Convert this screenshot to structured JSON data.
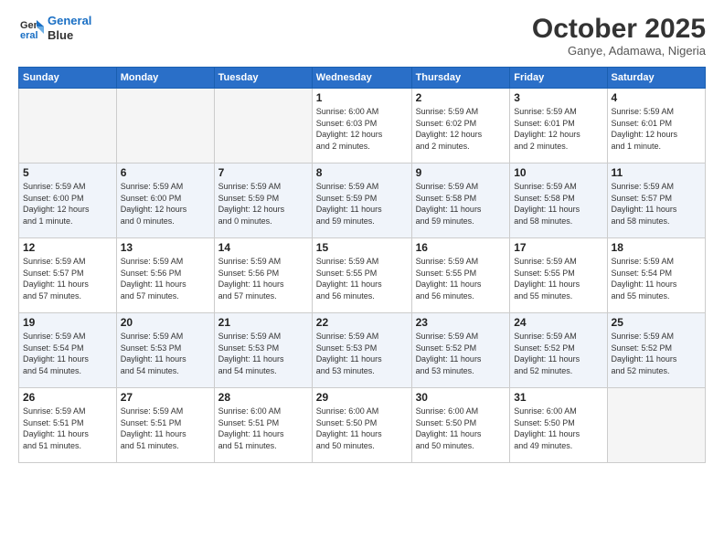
{
  "header": {
    "logo_line1": "General",
    "logo_line2": "Blue",
    "month": "October 2025",
    "location": "Ganye, Adamawa, Nigeria"
  },
  "weekdays": [
    "Sunday",
    "Monday",
    "Tuesday",
    "Wednesday",
    "Thursday",
    "Friday",
    "Saturday"
  ],
  "weeks": [
    [
      {
        "day": "",
        "info": ""
      },
      {
        "day": "",
        "info": ""
      },
      {
        "day": "",
        "info": ""
      },
      {
        "day": "1",
        "info": "Sunrise: 6:00 AM\nSunset: 6:03 PM\nDaylight: 12 hours\nand 2 minutes."
      },
      {
        "day": "2",
        "info": "Sunrise: 5:59 AM\nSunset: 6:02 PM\nDaylight: 12 hours\nand 2 minutes."
      },
      {
        "day": "3",
        "info": "Sunrise: 5:59 AM\nSunset: 6:01 PM\nDaylight: 12 hours\nand 2 minutes."
      },
      {
        "day": "4",
        "info": "Sunrise: 5:59 AM\nSunset: 6:01 PM\nDaylight: 12 hours\nand 1 minute."
      }
    ],
    [
      {
        "day": "5",
        "info": "Sunrise: 5:59 AM\nSunset: 6:00 PM\nDaylight: 12 hours\nand 1 minute."
      },
      {
        "day": "6",
        "info": "Sunrise: 5:59 AM\nSunset: 6:00 PM\nDaylight: 12 hours\nand 0 minutes."
      },
      {
        "day": "7",
        "info": "Sunrise: 5:59 AM\nSunset: 5:59 PM\nDaylight: 12 hours\nand 0 minutes."
      },
      {
        "day": "8",
        "info": "Sunrise: 5:59 AM\nSunset: 5:59 PM\nDaylight: 11 hours\nand 59 minutes."
      },
      {
        "day": "9",
        "info": "Sunrise: 5:59 AM\nSunset: 5:58 PM\nDaylight: 11 hours\nand 59 minutes."
      },
      {
        "day": "10",
        "info": "Sunrise: 5:59 AM\nSunset: 5:58 PM\nDaylight: 11 hours\nand 58 minutes."
      },
      {
        "day": "11",
        "info": "Sunrise: 5:59 AM\nSunset: 5:57 PM\nDaylight: 11 hours\nand 58 minutes."
      }
    ],
    [
      {
        "day": "12",
        "info": "Sunrise: 5:59 AM\nSunset: 5:57 PM\nDaylight: 11 hours\nand 57 minutes."
      },
      {
        "day": "13",
        "info": "Sunrise: 5:59 AM\nSunset: 5:56 PM\nDaylight: 11 hours\nand 57 minutes."
      },
      {
        "day": "14",
        "info": "Sunrise: 5:59 AM\nSunset: 5:56 PM\nDaylight: 11 hours\nand 57 minutes."
      },
      {
        "day": "15",
        "info": "Sunrise: 5:59 AM\nSunset: 5:55 PM\nDaylight: 11 hours\nand 56 minutes."
      },
      {
        "day": "16",
        "info": "Sunrise: 5:59 AM\nSunset: 5:55 PM\nDaylight: 11 hours\nand 56 minutes."
      },
      {
        "day": "17",
        "info": "Sunrise: 5:59 AM\nSunset: 5:55 PM\nDaylight: 11 hours\nand 55 minutes."
      },
      {
        "day": "18",
        "info": "Sunrise: 5:59 AM\nSunset: 5:54 PM\nDaylight: 11 hours\nand 55 minutes."
      }
    ],
    [
      {
        "day": "19",
        "info": "Sunrise: 5:59 AM\nSunset: 5:54 PM\nDaylight: 11 hours\nand 54 minutes."
      },
      {
        "day": "20",
        "info": "Sunrise: 5:59 AM\nSunset: 5:53 PM\nDaylight: 11 hours\nand 54 minutes."
      },
      {
        "day": "21",
        "info": "Sunrise: 5:59 AM\nSunset: 5:53 PM\nDaylight: 11 hours\nand 54 minutes."
      },
      {
        "day": "22",
        "info": "Sunrise: 5:59 AM\nSunset: 5:53 PM\nDaylight: 11 hours\nand 53 minutes."
      },
      {
        "day": "23",
        "info": "Sunrise: 5:59 AM\nSunset: 5:52 PM\nDaylight: 11 hours\nand 53 minutes."
      },
      {
        "day": "24",
        "info": "Sunrise: 5:59 AM\nSunset: 5:52 PM\nDaylight: 11 hours\nand 52 minutes."
      },
      {
        "day": "25",
        "info": "Sunrise: 5:59 AM\nSunset: 5:52 PM\nDaylight: 11 hours\nand 52 minutes."
      }
    ],
    [
      {
        "day": "26",
        "info": "Sunrise: 5:59 AM\nSunset: 5:51 PM\nDaylight: 11 hours\nand 51 minutes."
      },
      {
        "day": "27",
        "info": "Sunrise: 5:59 AM\nSunset: 5:51 PM\nDaylight: 11 hours\nand 51 minutes."
      },
      {
        "day": "28",
        "info": "Sunrise: 6:00 AM\nSunset: 5:51 PM\nDaylight: 11 hours\nand 51 minutes."
      },
      {
        "day": "29",
        "info": "Sunrise: 6:00 AM\nSunset: 5:50 PM\nDaylight: 11 hours\nand 50 minutes."
      },
      {
        "day": "30",
        "info": "Sunrise: 6:00 AM\nSunset: 5:50 PM\nDaylight: 11 hours\nand 50 minutes."
      },
      {
        "day": "31",
        "info": "Sunrise: 6:00 AM\nSunset: 5:50 PM\nDaylight: 11 hours\nand 49 minutes."
      },
      {
        "day": "",
        "info": ""
      }
    ]
  ]
}
